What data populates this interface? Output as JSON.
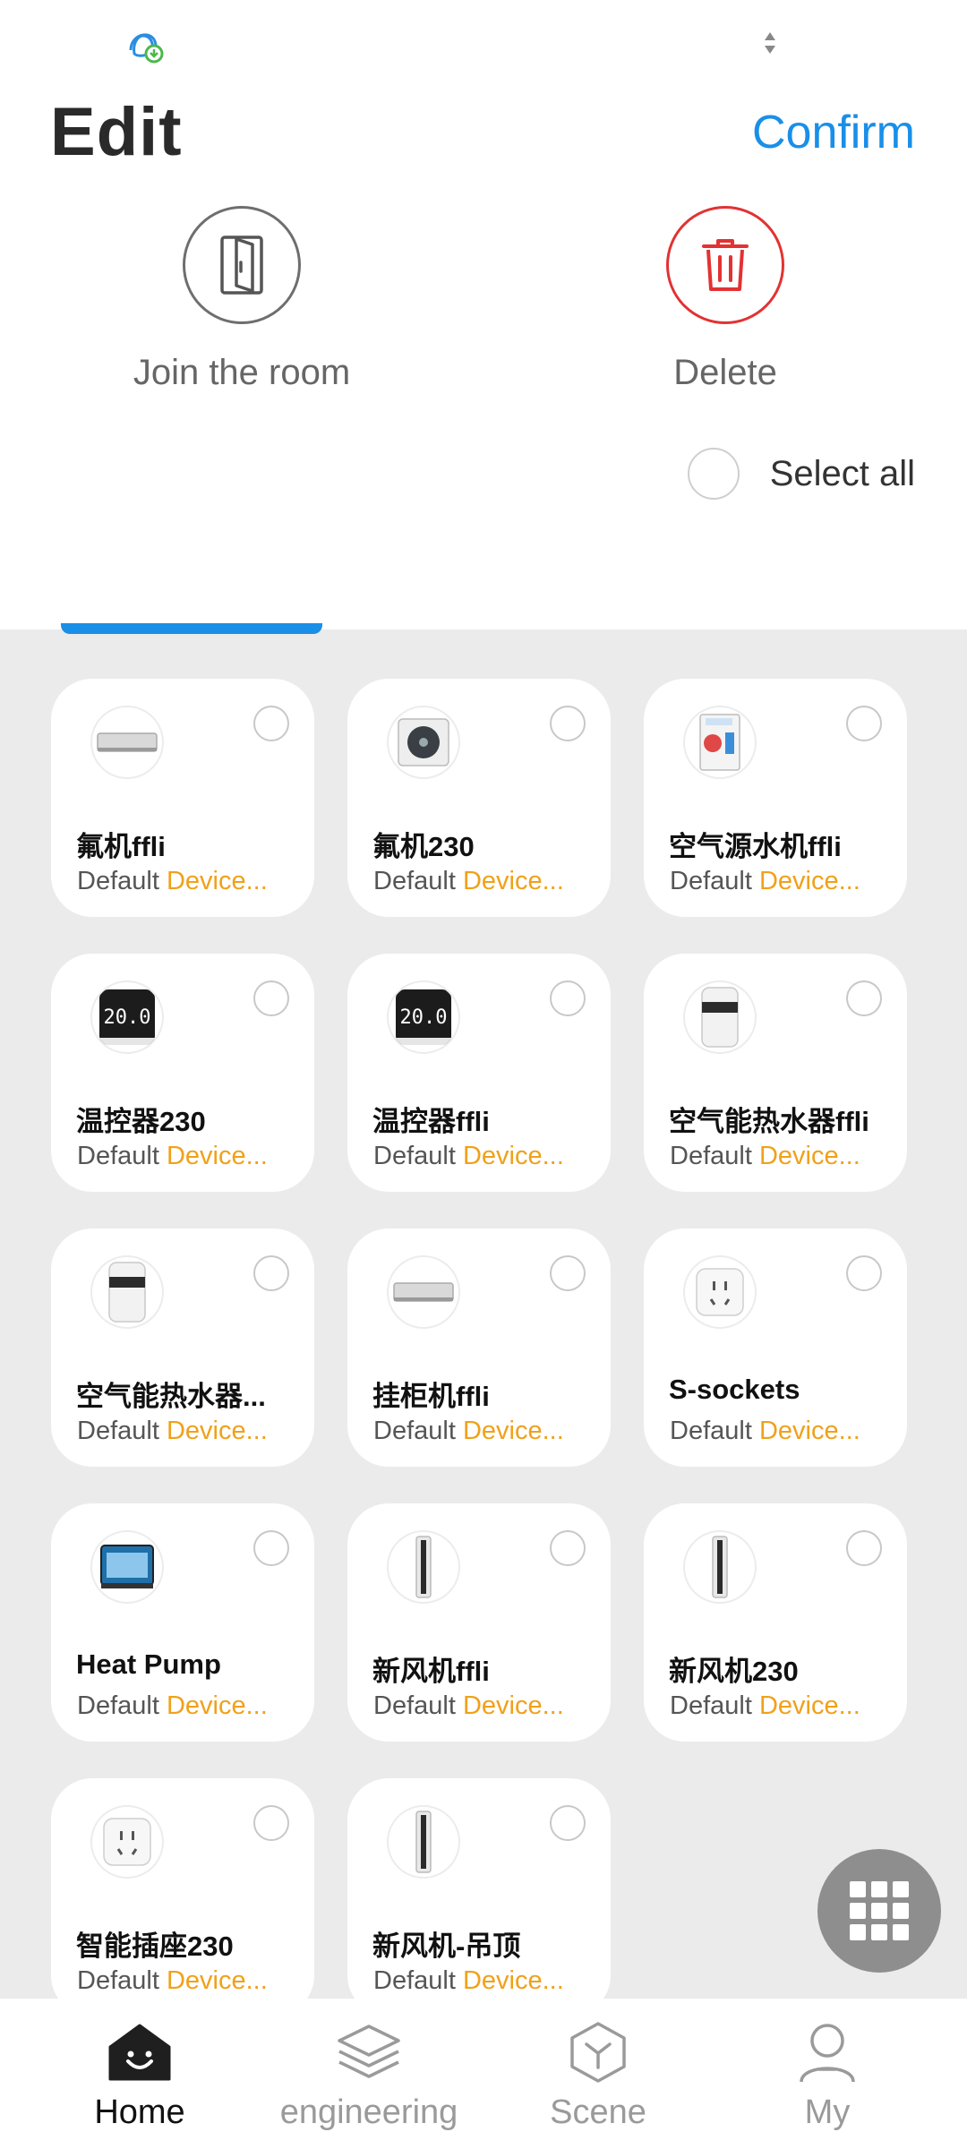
{
  "status": {
    "app_icon": "customer-service-icon",
    "arrows_icon": "sort-arrows-icon"
  },
  "header": {
    "title": "Edit",
    "confirm_label": "Confirm"
  },
  "actions": {
    "join": {
      "label": "Join the room",
      "icon": "door-icon"
    },
    "delete": {
      "label": "Delete",
      "icon": "trash-icon",
      "color": "#e23232"
    }
  },
  "select_all": {
    "label": "Select all"
  },
  "accent": "#1a8fe8",
  "devices": [
    {
      "name": "氟机ffli",
      "room": "Default",
      "type": "Device...",
      "icon": "ac-indoor-unit"
    },
    {
      "name": "氟机230",
      "room": "Default",
      "type": "Device...",
      "icon": "ac-outdoor-unit"
    },
    {
      "name": "空气源水机ffli",
      "room": "Default",
      "type": "Device...",
      "icon": "heat-pump-unit"
    },
    {
      "name": "温控器230",
      "room": "Default",
      "type": "Device...",
      "icon": "thermostat"
    },
    {
      "name": "温控器ffli",
      "room": "Default",
      "type": "Device...",
      "icon": "thermostat"
    },
    {
      "name": "空气能热水器ffli",
      "room": "Default",
      "type": "Device...",
      "icon": "water-heater"
    },
    {
      "name": "空气能热水器...",
      "room": "Default",
      "type": "Device...",
      "icon": "water-heater"
    },
    {
      "name": "挂柜机ffli",
      "room": "Default",
      "type": "Device...",
      "icon": "ac-indoor-unit"
    },
    {
      "name": "S-sockets",
      "room": "Default",
      "type": "Device...",
      "icon": "socket"
    },
    {
      "name": "Heat Pump",
      "room": "Default",
      "type": "Device...",
      "icon": "heat-pump-box"
    },
    {
      "name": "新风机ffli",
      "room": "Default",
      "type": "Device...",
      "icon": "tower-purifier"
    },
    {
      "name": "新风机230",
      "room": "Default",
      "type": "Device...",
      "icon": "tower-purifier"
    },
    {
      "name": "智能插座230",
      "room": "Default",
      "type": "Device...",
      "icon": "socket"
    },
    {
      "name": "新风机-吊顶",
      "room": "Default",
      "type": "Device...",
      "icon": "tower-purifier"
    }
  ],
  "fab": {
    "icon": "grid-icon"
  },
  "nav": [
    {
      "label": "Home",
      "icon": "home-icon",
      "active": true
    },
    {
      "label": "engineering",
      "icon": "layers-icon",
      "active": false
    },
    {
      "label": "Scene",
      "icon": "scene-icon",
      "active": false
    },
    {
      "label": "My",
      "icon": "profile-icon",
      "active": false
    }
  ]
}
